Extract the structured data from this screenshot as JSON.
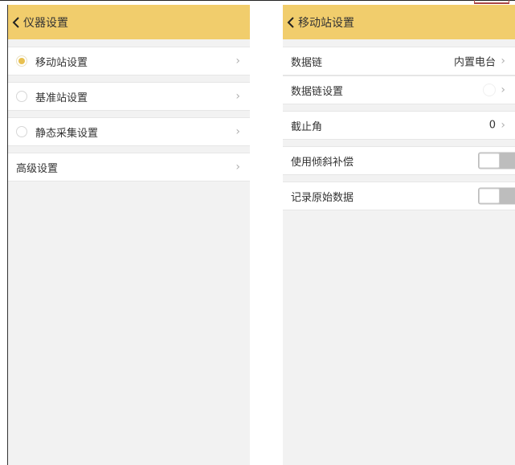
{
  "screen_left": {
    "title": "仪器设置",
    "items": [
      {
        "label": "移动站设置",
        "selected": true
      },
      {
        "label": "基准站设置",
        "selected": false
      },
      {
        "label": "静态采集设置",
        "selected": false
      }
    ],
    "advanced": {
      "label": "高级设置"
    }
  },
  "screen_right": {
    "title": "移动站设置",
    "rows": {
      "data_link": {
        "label": "数据链",
        "value": "内置电台"
      },
      "data_link_settings": {
        "label": "数据链设置"
      },
      "cutoff_angle": {
        "label": "截止角",
        "value": "0"
      },
      "tilt_compensation": {
        "label": "使用倾斜补偿",
        "enabled": false
      },
      "record_raw": {
        "label": "记录原始数据",
        "enabled": false
      }
    }
  },
  "icons": {
    "back": "chevron-left-icon",
    "forward": "chevron-right-icon"
  },
  "colors": {
    "header": "#f1cd6c",
    "radio_selected": "#e8c050",
    "background": "#f2f2f2"
  }
}
